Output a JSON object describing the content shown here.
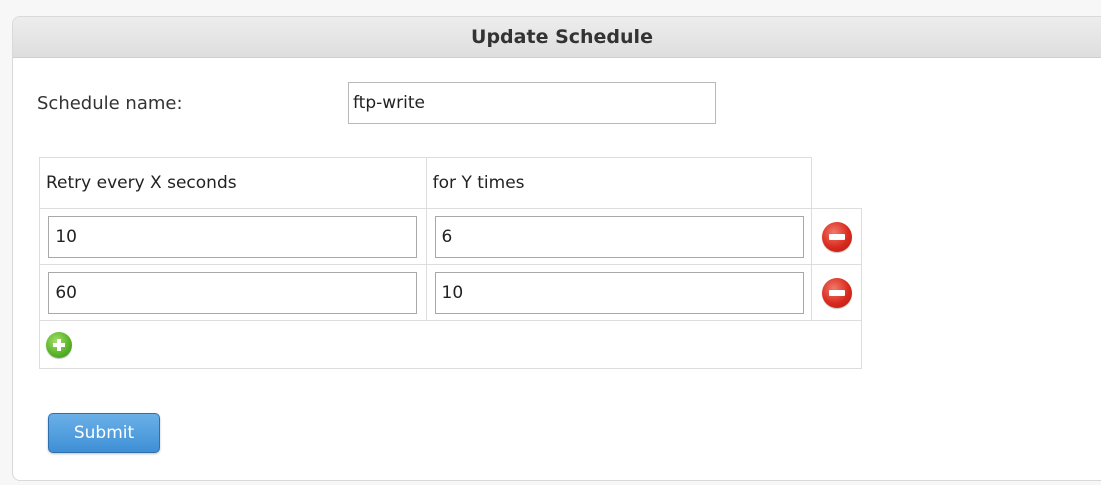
{
  "panel": {
    "title": "Update Schedule"
  },
  "schedule": {
    "name_label": "Schedule name:",
    "name_value": "ftp-write"
  },
  "table": {
    "headers": [
      "Retry every X seconds",
      "for Y times"
    ],
    "rows": [
      {
        "seconds": "10",
        "times": "6"
      },
      {
        "seconds": "60",
        "times": "10"
      }
    ]
  },
  "icons": {
    "remove": "minus-circle-icon",
    "add": "plus-circle-icon"
  },
  "submit": {
    "label": "Submit"
  }
}
